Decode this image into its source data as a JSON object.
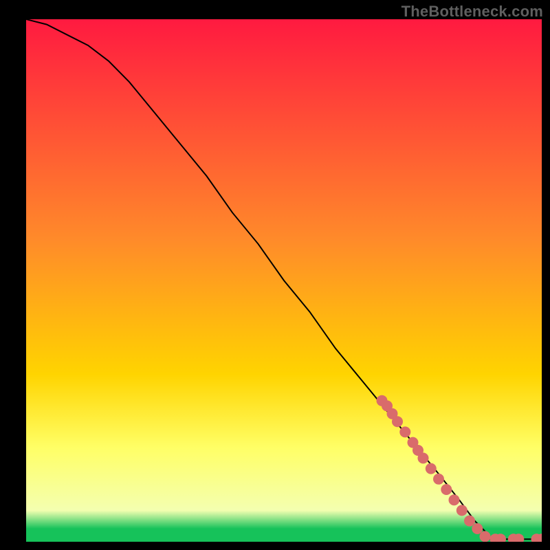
{
  "attribution": "TheBottleneck.com",
  "colors": {
    "background": "#000000",
    "attribution_text": "#5f5f5f",
    "curve": "#000000",
    "marker": "#d96b6b",
    "gradient_top": "#ff1a40",
    "gradient_mid": "#ffd400",
    "gradient_band": "#ffff66",
    "gradient_green": "#16c25a"
  },
  "chart_data": {
    "type": "line",
    "title": "",
    "xlabel": "",
    "ylabel": "",
    "xlim": [
      0,
      100
    ],
    "ylim": [
      0,
      100
    ],
    "grid": false,
    "legend": false,
    "series": [
      {
        "name": "bottleneck-curve",
        "x": [
          0,
          4,
          8,
          12,
          16,
          20,
          25,
          30,
          35,
          40,
          45,
          50,
          55,
          60,
          65,
          70,
          75,
          80,
          84,
          87,
          89,
          90,
          92,
          94,
          96,
          98,
          100
        ],
        "y": [
          100,
          99,
          97,
          95,
          92,
          88,
          82,
          76,
          70,
          63,
          57,
          50,
          44,
          37,
          31,
          25,
          19,
          13,
          8,
          4,
          2,
          0.5,
          0.5,
          0.5,
          0.5,
          0.5,
          0.5
        ]
      }
    ],
    "markers": [
      {
        "x": 69,
        "y": 27
      },
      {
        "x": 70,
        "y": 26
      },
      {
        "x": 71,
        "y": 24.5
      },
      {
        "x": 72,
        "y": 23
      },
      {
        "x": 73.5,
        "y": 21
      },
      {
        "x": 75,
        "y": 19
      },
      {
        "x": 76,
        "y": 17.5
      },
      {
        "x": 77,
        "y": 16
      },
      {
        "x": 78.5,
        "y": 14
      },
      {
        "x": 80,
        "y": 12
      },
      {
        "x": 81.5,
        "y": 10
      },
      {
        "x": 83,
        "y": 8
      },
      {
        "x": 84.5,
        "y": 6
      },
      {
        "x": 86,
        "y": 4
      },
      {
        "x": 87.5,
        "y": 2.5
      },
      {
        "x": 89,
        "y": 1
      },
      {
        "x": 91,
        "y": 0.5
      },
      {
        "x": 92,
        "y": 0.5
      },
      {
        "x": 94.5,
        "y": 0.5
      },
      {
        "x": 95.5,
        "y": 0.5
      },
      {
        "x": 99,
        "y": 0.5
      },
      {
        "x": 100,
        "y": 0.5
      }
    ]
  }
}
